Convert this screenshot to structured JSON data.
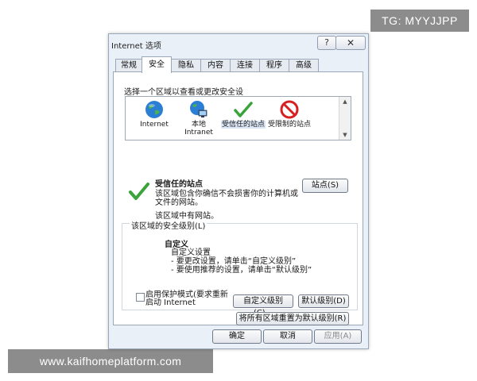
{
  "watermarks": {
    "top": "TG: MYYJJPP",
    "bottom": "www.kaifhomeplatform.com"
  },
  "dialog": {
    "title": "Internet 选项",
    "help_label": "?",
    "close_label": "✕",
    "tabs": [
      {
        "label": "常规",
        "active": false
      },
      {
        "label": "安全",
        "active": true
      },
      {
        "label": "隐私",
        "active": false
      },
      {
        "label": "内容",
        "active": false
      },
      {
        "label": "连接",
        "active": false
      },
      {
        "label": "程序",
        "active": false
      },
      {
        "label": "高级",
        "active": false
      }
    ]
  },
  "security": {
    "zone_prompt": "选择一个区域以查看或更改安全设",
    "zones": [
      {
        "label": "Internet",
        "icon": "globe-icon"
      },
      {
        "label": "本地 Intranet",
        "icon": "local-intranet-icon"
      },
      {
        "label": "受信任的站点",
        "icon": "green-check-icon",
        "selected": true
      },
      {
        "label": "受限制的站点",
        "icon": "no-entry-icon"
      }
    ],
    "selected_zone": {
      "title": "受信任的站点",
      "description": "该区域包含你确信不会损害你的计算机或文件的网站。",
      "no_sites": "该区域中有网站。",
      "sites_button": "站点(S)"
    },
    "level": {
      "legend": "该区域的安全级别(L)",
      "custom_title": "自定义",
      "lines": [
        "自定义设置",
        "- 要更改设置，请单击“自定义级别”",
        "- 要使用推荐的设置，请单击“默认级别”"
      ]
    },
    "protected_mode": "启用保护模式(要求重新启动 Internet",
    "custom_level_button": "自定义级别(C)...",
    "default_level_button": "默认级别(D)",
    "reset_all_button": "将所有区域重置为默认级别(R)"
  },
  "footer": {
    "ok": "确定",
    "cancel": "取消",
    "apply": "应用(A)"
  }
}
